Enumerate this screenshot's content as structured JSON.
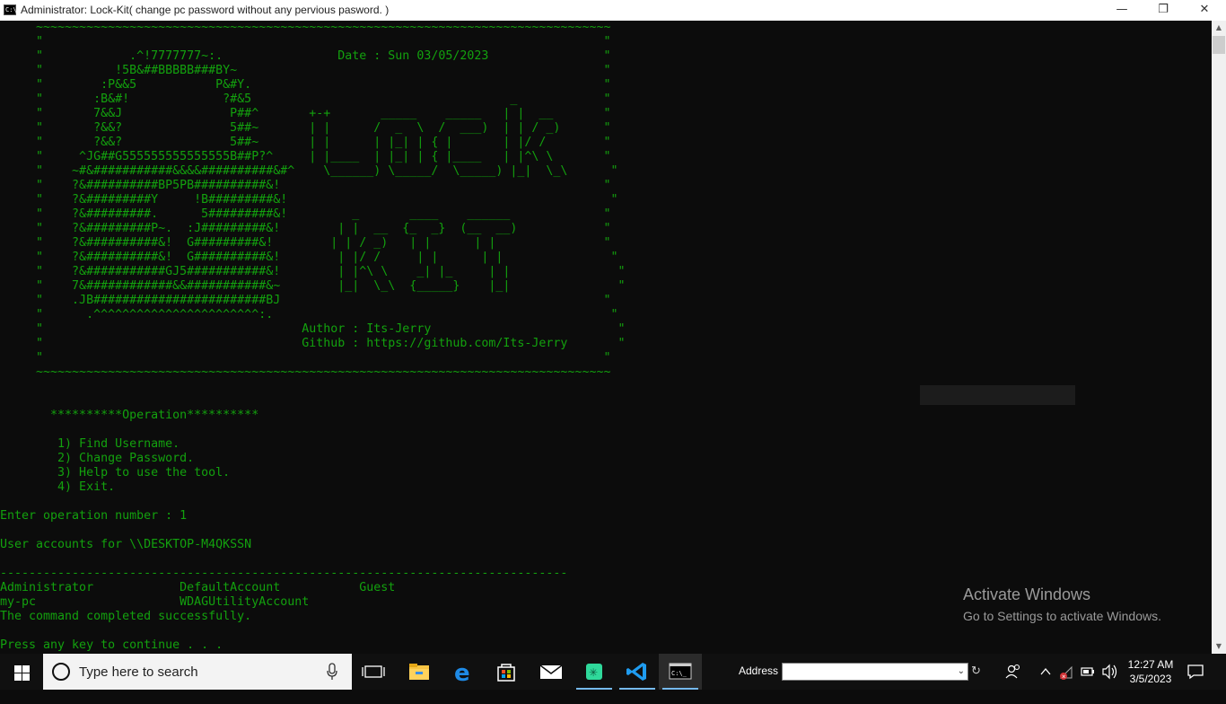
{
  "window": {
    "title": "Administrator:  Lock-Kit( change pc password without any pervious pasword. )",
    "minimize_glyph": "—",
    "restore_glyph": "❐",
    "close_glyph": "✕"
  },
  "console": {
    "lines": [
      "     ~~~~~~~~~~~~~~~~~~~~~~~~~~~~~~~~~~~~~~~~~~~~~~~~~~~~~~~~~~~~~~~~~~~~~~~~~~~~~~~~",
      "     \"                                                                              \"",
      "     \"            .^!7777777~:.                Date : Sun 03/05/2023                \"",
      "     \"          !5B&##BBBBB###BY~                                                   \"",
      "     \"        :P&&5           P&#Y.                                                 \"",
      "     \"       :B&#!             ?#&5                                    _            \"",
      "     \"       7&&J               P##^       +-+       _____    _____   | |  __       \"",
      "     \"       ?&&?               5##~       | |      /  _  \\  /  ___)  | | / _)      \"",
      "     \"       ?&&?               5##~       | |      | |_| | { |       | |/ /        \"",
      "     \"     ^JG##G555555555555555B##P?^     | |____  | |_| | { |____   | |^\\ \\       \"",
      "     \"    ~#&###########&&&&##########&#^    \\______) \\_____/  \\_____) |_|  \\_\\      \"",
      "     \"    ?&##########BP5PB##########&!                                             \"",
      "     \"    ?&#########Y     !B#########&!                                             \"",
      "     \"    ?&#########.      5#########&!         _       ____    ______             \"",
      "     \"    ?&#########P~.  :J#########&!        | |  __  {_  _}  (__  __)            \"",
      "     \"    ?&##########&!  G#########&!        | | / _)   | |      | |               \"",
      "     \"    ?&##########&!  G##########&!        | |/ /     | |      | |               \"",
      "     \"    ?&###########GJ5###########&!        | |^\\ \\    _| |_     | |               \"",
      "     \"    7&############&&###########&~        |_|  \\_\\  {_____}    |_|               \"",
      "     \"    .JB########################BJ                                             \"",
      "     \"      .^^^^^^^^^^^^^^^^^^^^^^^:.                                               \"",
      "     \"                                    Author : Its-Jerry                          \"",
      "     \"                                    Github : https://github.com/Its-Jerry       \"",
      "     \"                                                                              \"",
      "     ~~~~~~~~~~~~~~~~~~~~~~~~~~~~~~~~~~~~~~~~~~~~~~~~~~~~~~~~~~~~~~~~~~~~~~~~~~~~~~~~",
      "",
      "",
      "       **********Operation**********",
      "",
      "        1) Find Username.",
      "        2) Change Password.",
      "        3) Help to use the tool.",
      "        4) Exit.",
      "",
      "Enter operation number : 1",
      "",
      "User accounts for \\\\DESKTOP-M4QKSSN",
      "",
      "-------------------------------------------------------------------------------",
      "Administrator            DefaultAccount           Guest",
      "my-pc                    WDAGUtilityAccount",
      "The command completed successfully.",
      "",
      "Press any key to continue . . ."
    ]
  },
  "watermark": {
    "line1": "Activate Windows",
    "line2": "Go to Settings to activate Windows."
  },
  "taskbar": {
    "search_placeholder": "Type here to search",
    "address_label": "Address",
    "address_value": "",
    "time": "12:27 AM",
    "date": "3/5/2023"
  }
}
